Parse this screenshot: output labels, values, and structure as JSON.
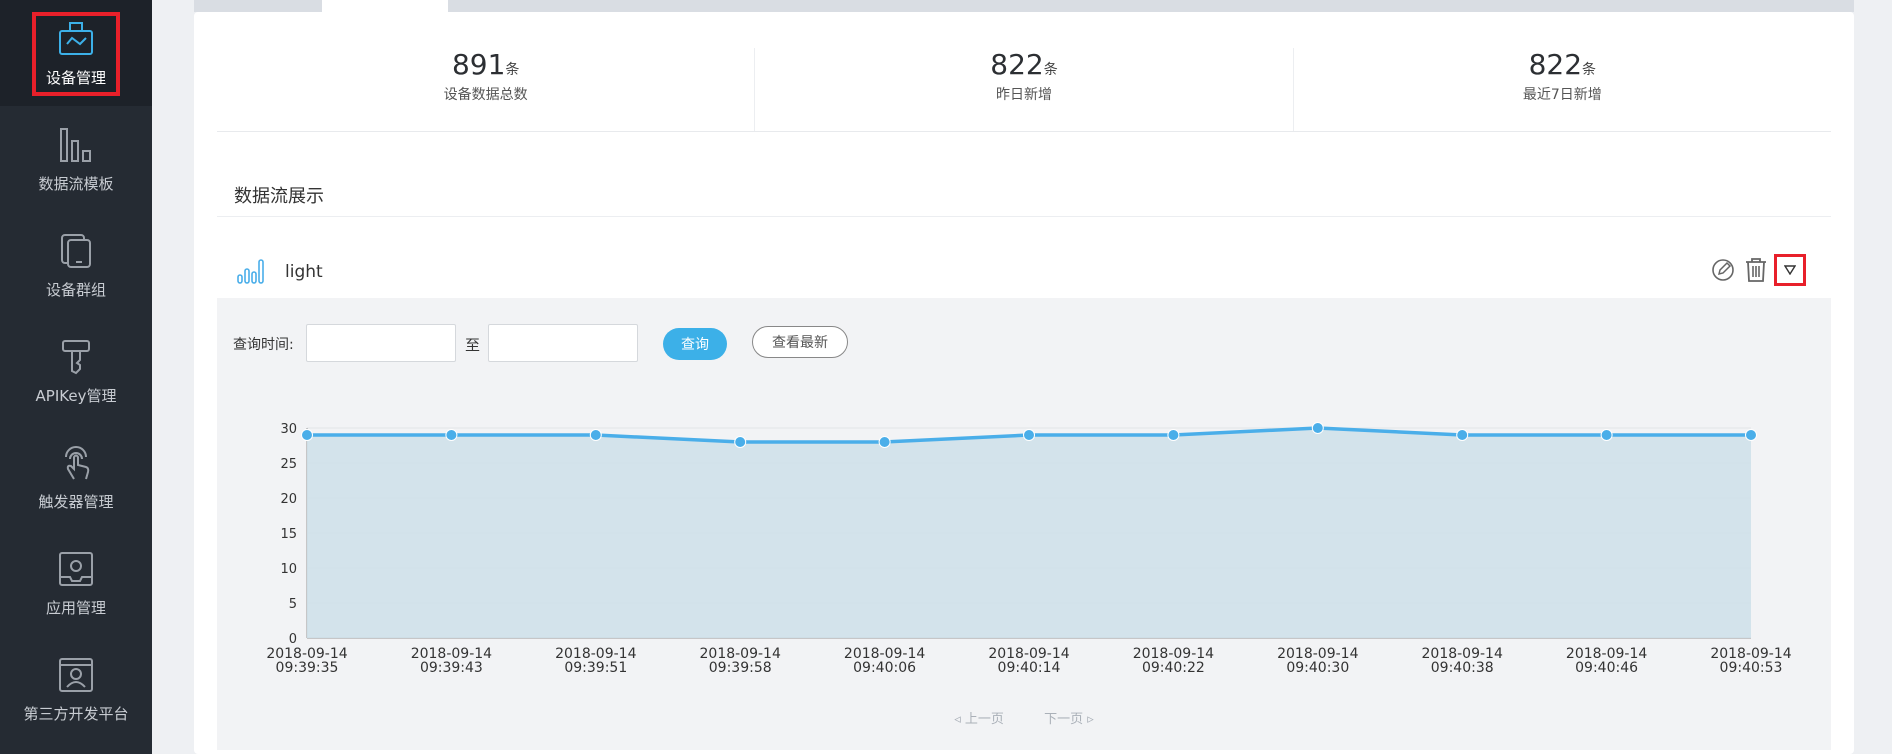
{
  "sidebar": {
    "items": [
      {
        "label": "设备管理",
        "icon": "device-management-icon"
      },
      {
        "label": "数据流模板",
        "icon": "datastream-template-icon"
      },
      {
        "label": "设备群组",
        "icon": "device-group-icon"
      },
      {
        "label": "APIKey管理",
        "icon": "apikey-icon"
      },
      {
        "label": "触发器管理",
        "icon": "trigger-icon"
      },
      {
        "label": "应用管理",
        "icon": "application-icon"
      },
      {
        "label": "第三方开发平台",
        "icon": "third-party-platform-icon"
      }
    ]
  },
  "stats": [
    {
      "value": "891",
      "unit": "条",
      "label": "设备数据总数"
    },
    {
      "value": "822",
      "unit": "条",
      "label": "昨日新增"
    },
    {
      "value": "822",
      "unit": "条",
      "label": "最近7日新增"
    }
  ],
  "section": {
    "title": "数据流展示"
  },
  "stream": {
    "name": "light"
  },
  "query": {
    "label": "查询时间:",
    "to_label": "至",
    "start_value": "",
    "end_value": "",
    "query_button": "查询",
    "latest_button": "查看最新"
  },
  "pager": {
    "prev": "◃ 上一页",
    "next": "下一页 ▹"
  },
  "colors": {
    "accent": "#3cb0e8",
    "line": "#4aaee9",
    "area": "#cfe1ea",
    "sidebar": "#252b33",
    "highlight": "#e8202a"
  },
  "chart_data": {
    "type": "area",
    "x": [
      [
        "2018-09-14",
        "09:39:35"
      ],
      [
        "2018-09-14",
        "09:39:43"
      ],
      [
        "2018-09-14",
        "09:39:51"
      ],
      [
        "2018-09-14",
        "09:39:58"
      ],
      [
        "2018-09-14",
        "09:40:06"
      ],
      [
        "2018-09-14",
        "09:40:14"
      ],
      [
        "2018-09-14",
        "09:40:22"
      ],
      [
        "2018-09-14",
        "09:40:30"
      ],
      [
        "2018-09-14",
        "09:40:38"
      ],
      [
        "2018-09-14",
        "09:40:46"
      ],
      [
        "2018-09-14",
        "09:40:53"
      ]
    ],
    "values": [
      29,
      29,
      29,
      28,
      28,
      29,
      29,
      30,
      29,
      29,
      29
    ],
    "yticks": [
      0,
      5,
      10,
      15,
      20,
      25,
      30
    ],
    "ylim": [
      0,
      30
    ],
    "grid": true
  }
}
